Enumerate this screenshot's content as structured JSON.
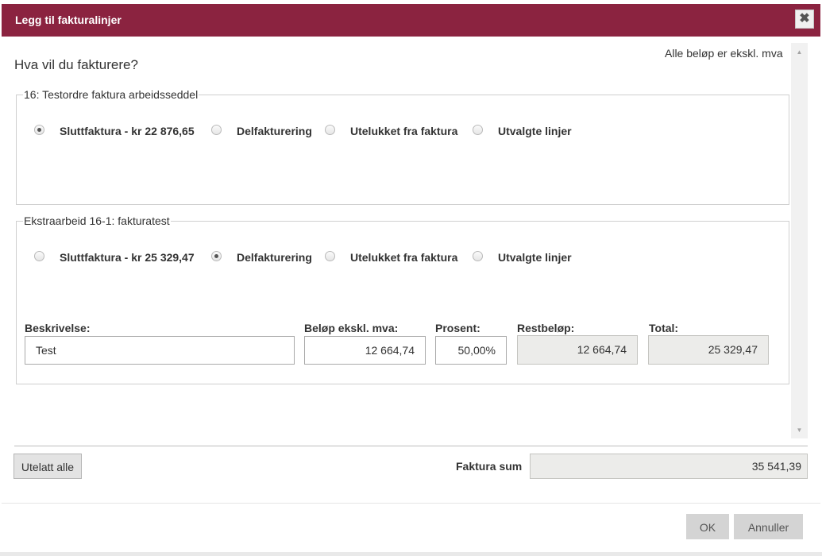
{
  "dialog": {
    "title": "Legg til fakturalinjer",
    "close_icon": "✖"
  },
  "header": {
    "question": "Hva vil du fakturere?",
    "vat_note": "Alle beløp er ekskl. mva"
  },
  "scrollbar": {
    "up_arrow": "▲",
    "down_arrow": "▼"
  },
  "groups": [
    {
      "legend": "16: Testordre faktura arbeidsseddel",
      "options": [
        {
          "label": "Sluttfaktura - kr 22 876,65",
          "checked": true
        },
        {
          "label": "Delfakturering",
          "checked": false
        },
        {
          "label": "Utelukket fra faktura",
          "checked": false
        },
        {
          "label": "Utvalgte linjer",
          "checked": false
        }
      ]
    },
    {
      "legend": "Ekstraarbeid 16-1: fakturatest",
      "options": [
        {
          "label": "Sluttfaktura - kr 25 329,47",
          "checked": false
        },
        {
          "label": "Delfakturering",
          "checked": true
        },
        {
          "label": "Utelukket fra faktura",
          "checked": false
        },
        {
          "label": "Utvalgte linjer",
          "checked": false
        }
      ],
      "fields": {
        "description": {
          "label": "Beskrivelse:",
          "value": "Test"
        },
        "amount": {
          "label": "Beløp ekskl. mva:",
          "value": "12 664,74"
        },
        "percent": {
          "label": "Prosent:",
          "value": "50,00%"
        },
        "remaining": {
          "label": "Restbeløp:",
          "value": "12 664,74"
        },
        "total": {
          "label": "Total:",
          "value": "25 329,47"
        }
      }
    }
  ],
  "footer": {
    "exclude_all_label": "Utelatt alle",
    "sum_label": "Faktura sum",
    "sum_value": "35 541,39",
    "ok_label": "OK",
    "cancel_label": "Annuller"
  }
}
